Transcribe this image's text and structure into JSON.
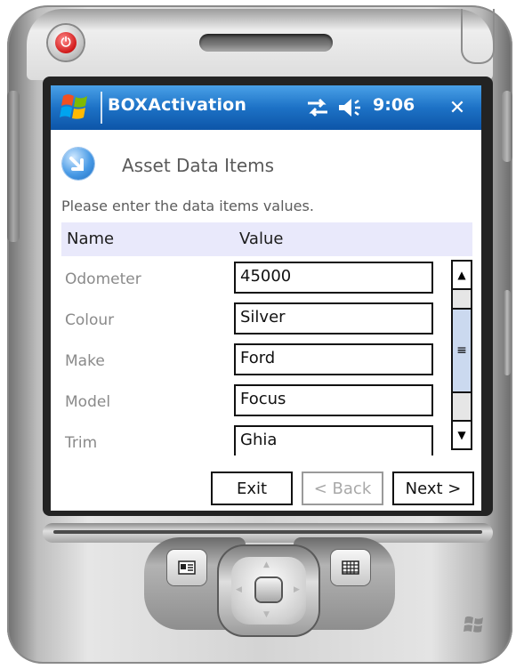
{
  "device": {
    "power_icon": "power-icon"
  },
  "titlebar": {
    "app_title": "BOXActivation",
    "time": "9:06",
    "close_glyph": "✕",
    "icons": [
      "windows-flag-icon",
      "sync-icon",
      "speaker-icon"
    ]
  },
  "page": {
    "title": "Asset Data Items",
    "instructions": "Please enter the data items values."
  },
  "table": {
    "headers": {
      "name": "Name",
      "value": "Value"
    },
    "rows": [
      {
        "label": "Odometer",
        "value": "45000"
      },
      {
        "label": "Colour",
        "value": "Silver"
      },
      {
        "label": "Make",
        "value": "Ford"
      },
      {
        "label": "Model",
        "value": "Focus"
      },
      {
        "label": "Trim",
        "value": "Ghia"
      }
    ]
  },
  "buttons": {
    "exit": "Exit",
    "back": "< Back",
    "next": "Next >"
  },
  "colors": {
    "titlebar": "#1d72c6",
    "header_row": "#e9e9fb"
  }
}
